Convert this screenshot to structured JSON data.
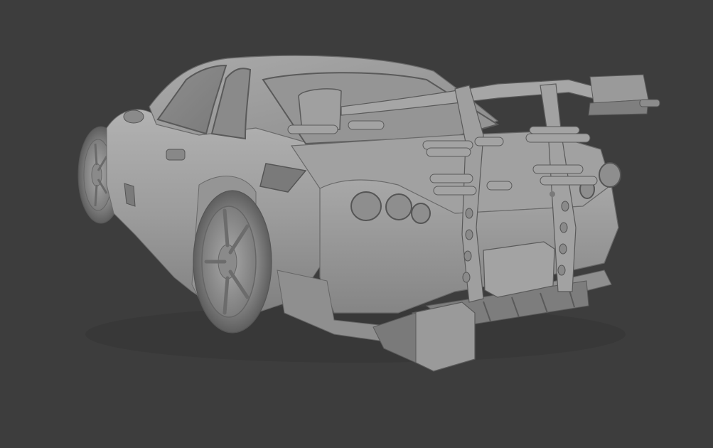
{
  "viewport": {
    "background": "#3d3d3d",
    "shading": "solid-clay"
  },
  "model": {
    "icon": "car-3d-model-icon",
    "colors": {
      "base": "#9a9a9a",
      "light": "#b4b4b4",
      "shadow": "#6c6c6c",
      "dark": "#4a4a4a",
      "outline": "#5a5a5a"
    }
  }
}
